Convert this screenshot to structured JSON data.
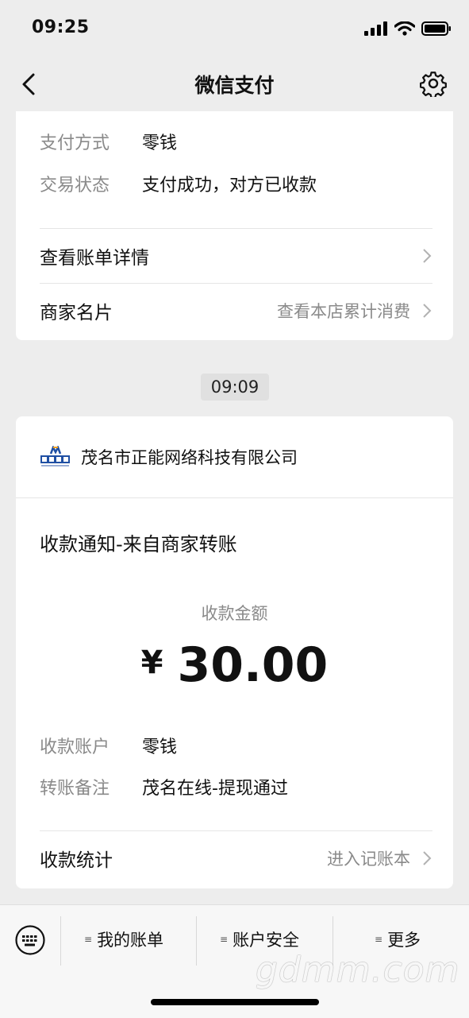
{
  "status_bar": {
    "time": "09:25"
  },
  "nav": {
    "title": "微信支付"
  },
  "payment_card": {
    "method_key": "支付方式",
    "method_value": "零钱",
    "state_key": "交易状态",
    "state_value": "支付成功，对方已收款",
    "bill_detail_label": "查看账单详情",
    "merchant_card_label": "商家名片",
    "merchant_card_hint": "查看本店累计消费"
  },
  "time_badge": "09:09",
  "receipt_card": {
    "merchant_name": "茂名市正能网络科技有限公司",
    "notice_title": "收款通知-来自商家转账",
    "amount_label": "收款金额",
    "currency": "¥",
    "amount": "30.00",
    "account_key": "收款账户",
    "account_value": "零钱",
    "remark_key": "转账备注",
    "remark_value": "茂名在线-提现通过",
    "stats_label": "收款统计",
    "stats_hint": "进入记账本"
  },
  "bottom_bar": {
    "tab1": "我的账单",
    "tab2": "账户安全",
    "tab3": "更多",
    "menu_glyph": "≡"
  },
  "watermark": "gdmm.com",
  "icons": [
    "back-icon",
    "gear-icon",
    "chevron-right-icon",
    "keyboard-icon",
    "signal-icon",
    "wifi-icon",
    "battery-icon",
    "merchant-logo"
  ]
}
